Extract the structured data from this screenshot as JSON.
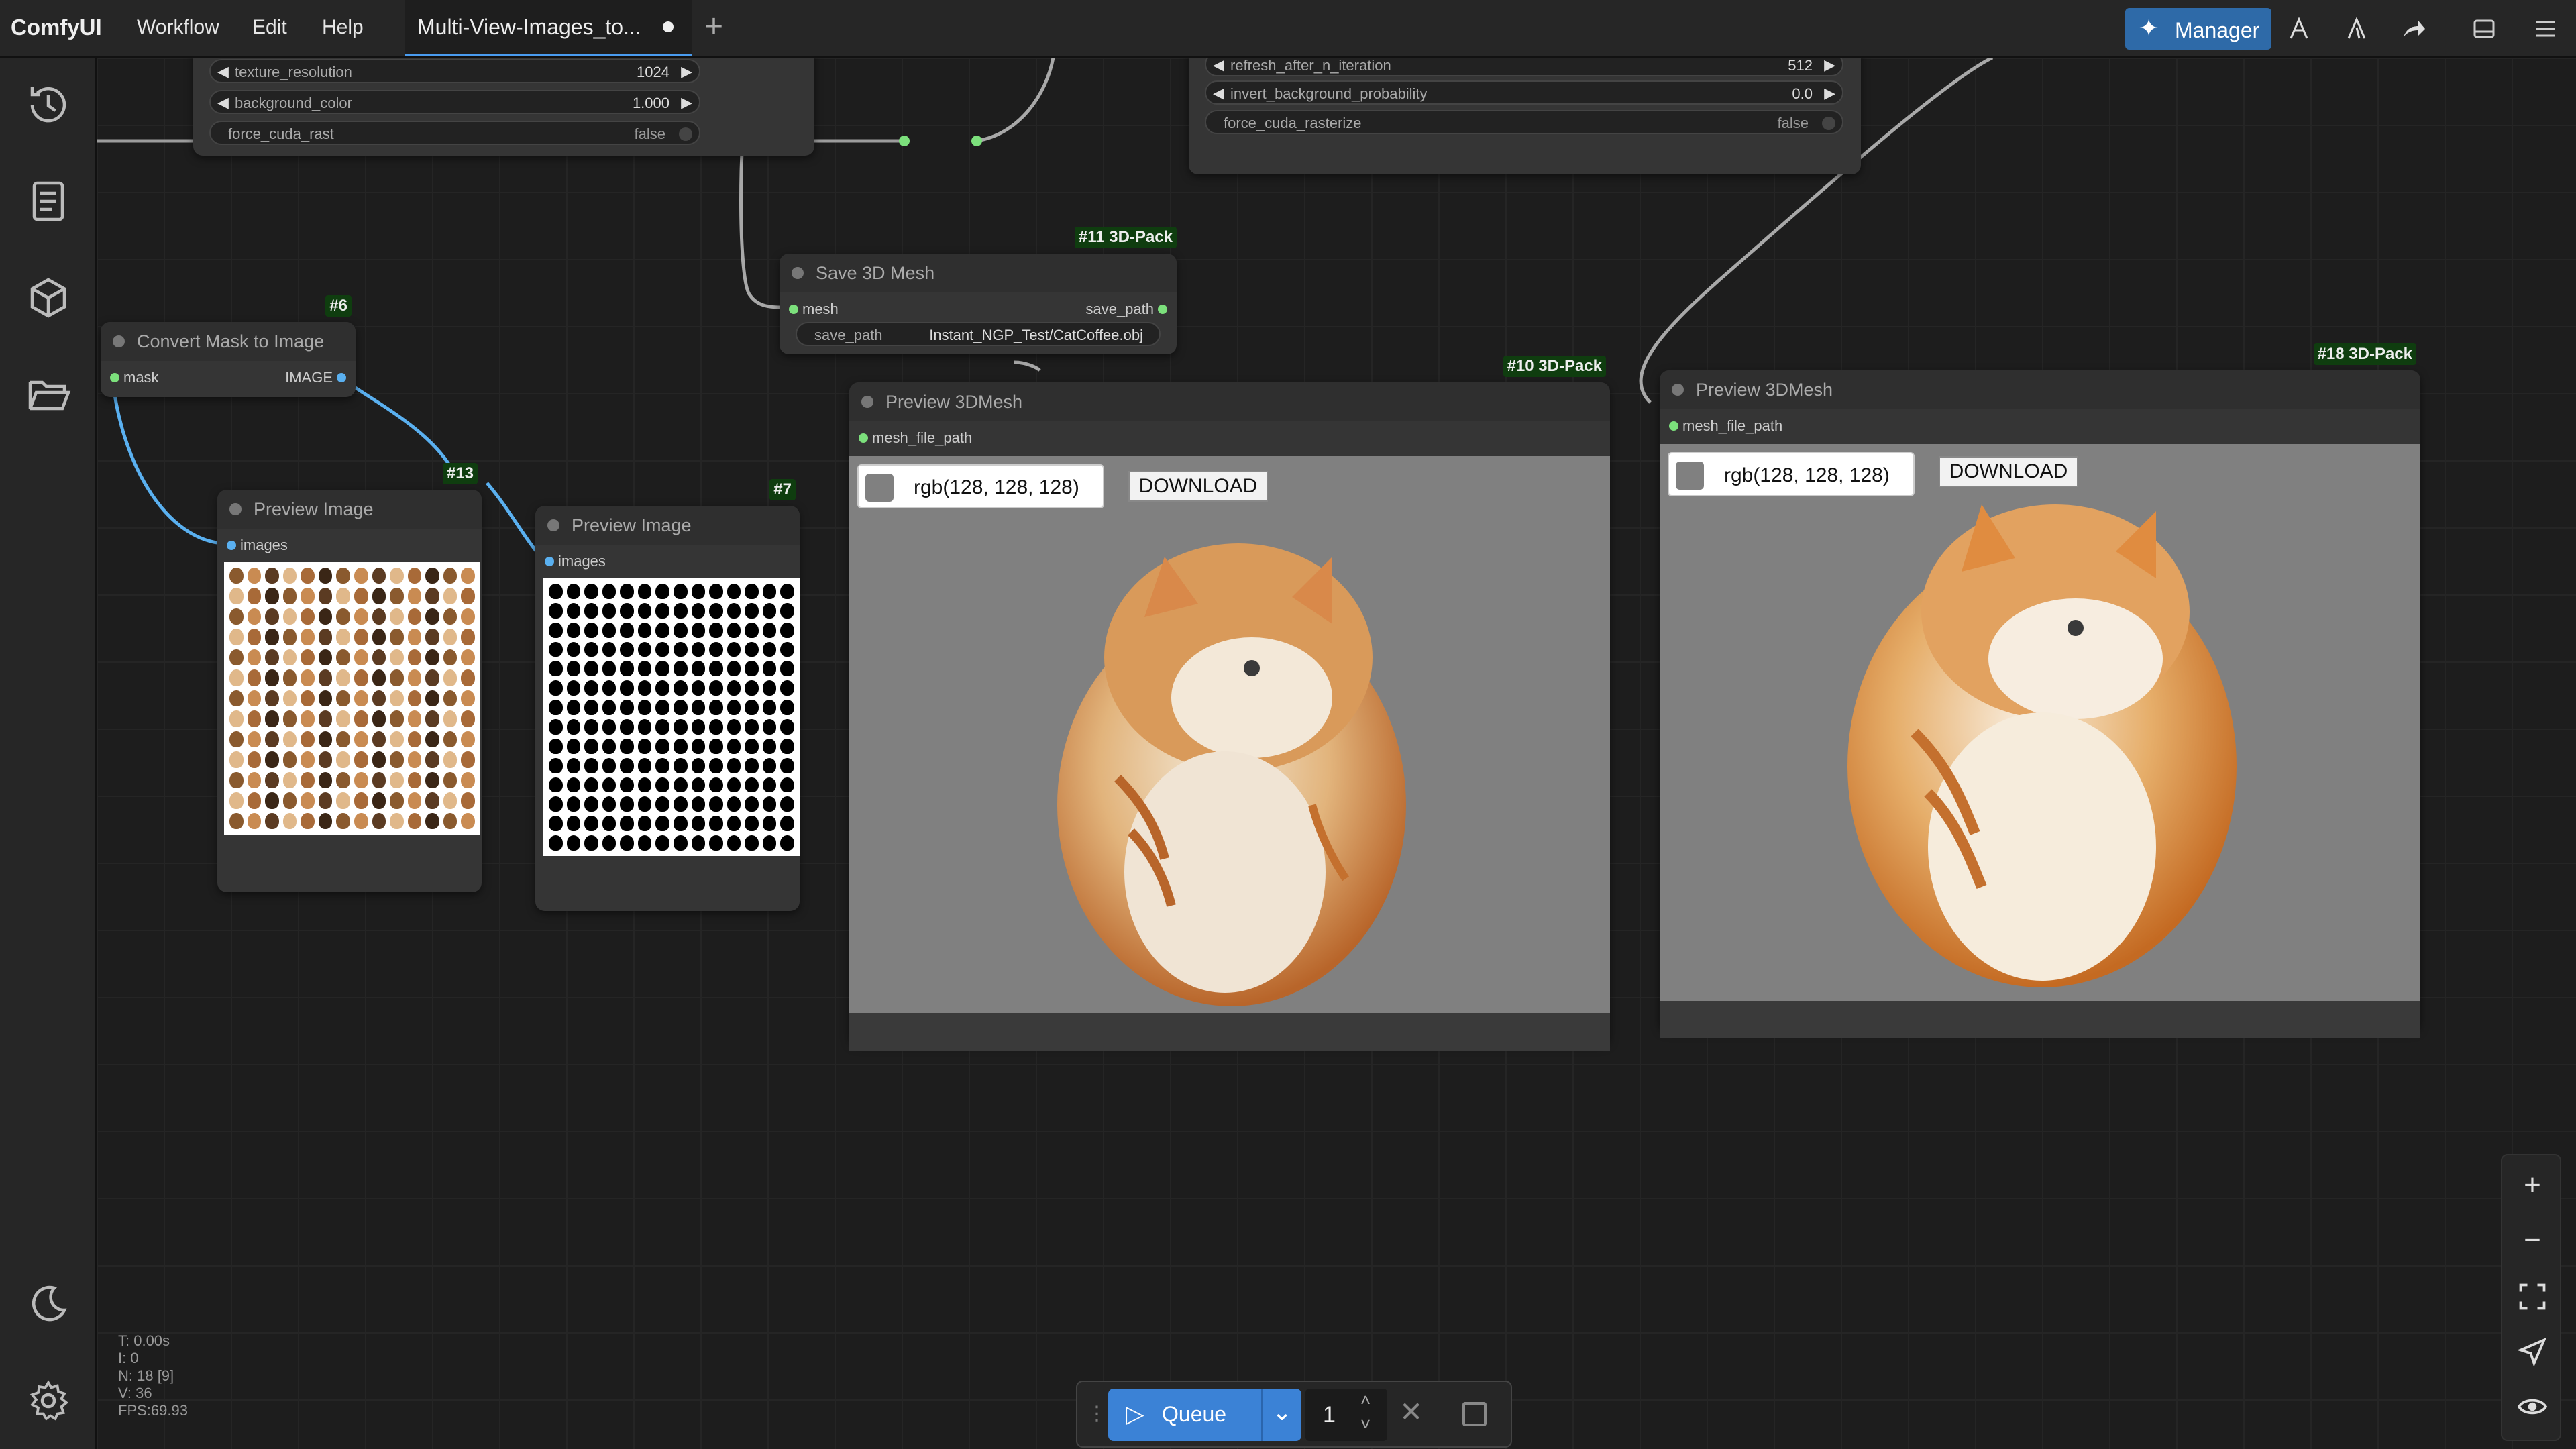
{
  "app": {
    "name": "ComfyUI",
    "menu": [
      "Workflow",
      "Edit",
      "Help"
    ],
    "tab_title": "Multi-View-Images_to...",
    "manager_label": "Manager",
    "accent_color": "#3b82d6",
    "icons": {
      "manager": "puzzle-icon",
      "top_right": [
        "comfy-a-icon",
        "comfy-b-icon",
        "share-icon",
        "panel-toggle-icon",
        "hamburger-icon"
      ]
    }
  },
  "sidebar": {
    "items": [
      "history-icon",
      "node-library-icon",
      "model-library-icon",
      "workflows-icon"
    ],
    "bottom": [
      "theme-icon",
      "settings-icon"
    ]
  },
  "nodes": {
    "top_left": {
      "widgets": [
        {
          "name": "texture_resolution",
          "value": "1024"
        },
        {
          "name": "background_color",
          "value": "1.000"
        },
        {
          "name": "force_cuda_rast",
          "value": "false"
        }
      ]
    },
    "top_right": {
      "widgets": [
        {
          "name": "refresh_after_n_iteration",
          "value": "512"
        },
        {
          "name": "invert_background_probability",
          "value": "0.0"
        },
        {
          "name": "force_cuda_rasterize",
          "value": "false"
        }
      ]
    },
    "save_mesh": {
      "badge": "#11 3D-Pack",
      "title": "Save 3D Mesh",
      "input": "mesh",
      "output": "save_path",
      "widget_name": "save_path",
      "widget_value": "Instant_NGP_Test/CatCoffee.obj"
    },
    "convert_mask": {
      "badge": "#6",
      "title": "Convert Mask to Image",
      "input": "mask",
      "output": "IMAGE"
    },
    "preview_image_13": {
      "badge": "#13",
      "title": "Preview Image",
      "input": "images"
    },
    "preview_image_7": {
      "badge": "#7",
      "title": "Preview Image",
      "input": "images"
    },
    "preview_3d_10": {
      "badge": "#10 3D-Pack",
      "title": "Preview 3DMesh",
      "input": "mesh_file_path",
      "bg_label": "rgb(128, 128, 128)",
      "download_label": "DOWNLOAD"
    },
    "preview_3d_18": {
      "badge": "#18 3D-Pack",
      "title": "Preview 3DMesh",
      "input": "mesh_file_path",
      "bg_label": "rgb(128, 128, 128)",
      "download_label": "DOWNLOAD"
    }
  },
  "stats": {
    "t": "T: 0.00s",
    "i": "I: 0",
    "n": "N: 18 [9]",
    "v": "V: 36",
    "fps": "FPS:69.93"
  },
  "queue": {
    "label": "Queue",
    "count": "1"
  },
  "zoom_controls": [
    "zoom-in-icon",
    "zoom-out-icon",
    "fit-view-icon",
    "select-mode-icon",
    "toggle-links-icon"
  ]
}
